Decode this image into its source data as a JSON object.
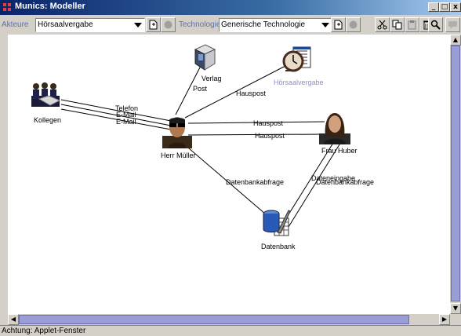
{
  "window": {
    "title": "Munics: Modeller",
    "controls": {
      "minimize": "_",
      "maximize": "□",
      "close": "x"
    }
  },
  "toolbar": {
    "akteure_label": "Akteure",
    "akteure_value": "Hörsaalvergabe",
    "technologien_label": "Technologien",
    "technologien_value": "Generische Technologie"
  },
  "nodes": {
    "kollegen": {
      "label": "Kollegen",
      "icon": "group-icon"
    },
    "verlag": {
      "label": "Verlag",
      "icon": "book-icon"
    },
    "hoersaalvergabe": {
      "label": "Hörsaalvergabe",
      "icon": "clock-calendar-icon",
      "color": "#8a8fc8"
    },
    "herr_mueller": {
      "label": "Herr Müller",
      "icon": "person-icon"
    },
    "frau_huber": {
      "label": "Frau Huber",
      "icon": "person-icon"
    },
    "datenbank": {
      "label": "Datenbank",
      "icon": "database-icon"
    }
  },
  "edges": {
    "telefon": "Telefon",
    "email1": "E-Mail",
    "email2": "E-Mail",
    "post": "Post",
    "hauspost_hoersaal": "Hauspost",
    "hauspost_huber1": "Hauspost",
    "hauspost_huber2": "Hauspost",
    "datenbankabfrage_mueller": "Datenbankabfrage",
    "dateneingabe": "Dateneingabe",
    "datenbankabfrage_huber": "Datenbankabfrage"
  },
  "status": {
    "text": "Achtung: Applet-Fenster"
  },
  "colors": {
    "titlebar": "#0a246a",
    "scroll_thumb": "#9a9dd6",
    "label_accent": "#5a6fb0"
  }
}
